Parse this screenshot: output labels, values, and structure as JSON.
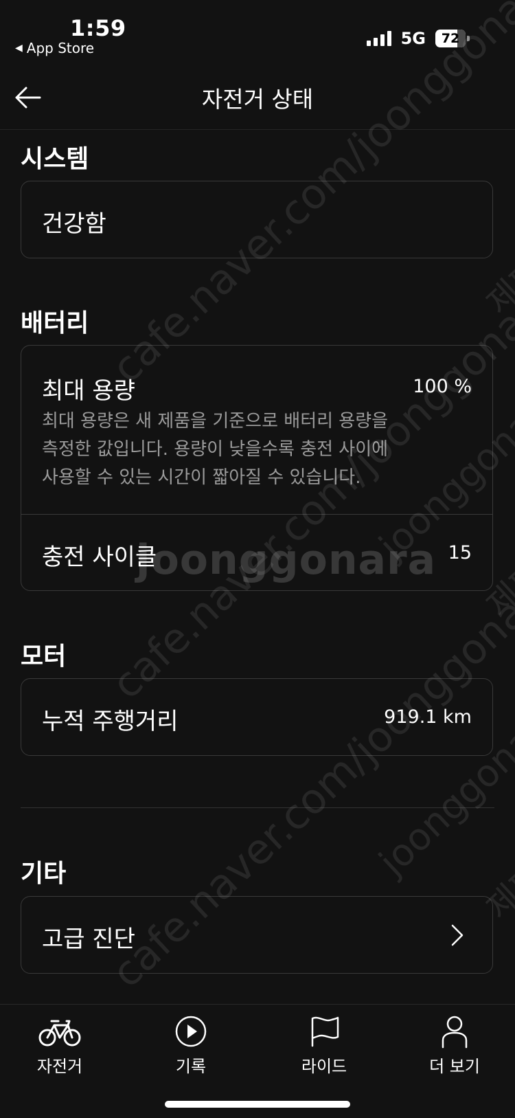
{
  "status_bar": {
    "time": "1:59",
    "back_app": "App Store",
    "network": "5G",
    "battery_level": "72",
    "battery_fraction": 0.72
  },
  "header": {
    "title": "자전거 상태"
  },
  "system": {
    "title": "시스템",
    "status": "건강함"
  },
  "battery": {
    "title": "배터리",
    "max_capacity_label": "최대 용량",
    "max_capacity_value": "100 %",
    "max_capacity_desc_lines": [
      "최대 용량은 새 제품을 기준으로 배터리 용량을",
      "측정한 값입니다. 용량이 낮을수록 충전 사이에",
      "사용할 수 있는 시간이 짧아질 수 있습니다."
    ],
    "charge_cycles_label": "충전 사이클",
    "charge_cycles_value": "15"
  },
  "motor": {
    "title": "모터",
    "odometer_label": "누적 주행거리",
    "odometer_value": "919.1 km"
  },
  "other": {
    "title": "기타",
    "advanced_diagnostics_label": "고급 진단"
  },
  "tab_bar": {
    "tabs": [
      {
        "label": "자전거",
        "icon": "bicycle-icon",
        "active": true
      },
      {
        "label": "기록",
        "icon": "play-circle-icon",
        "active": false
      },
      {
        "label": "라이드",
        "icon": "flag-icon",
        "active": false
      },
      {
        "label": "더 보기",
        "icon": "person-icon",
        "active": false
      }
    ]
  },
  "watermark": {
    "url_text": "cafe.naver.com/joonggonara",
    "logo_text": "joonggonara",
    "side_text": "제팬"
  },
  "colors": {
    "background": "#121212",
    "card_border": "#3a3a3a",
    "text_primary": "#ffffff",
    "text_secondary": "#9b9b9b"
  }
}
